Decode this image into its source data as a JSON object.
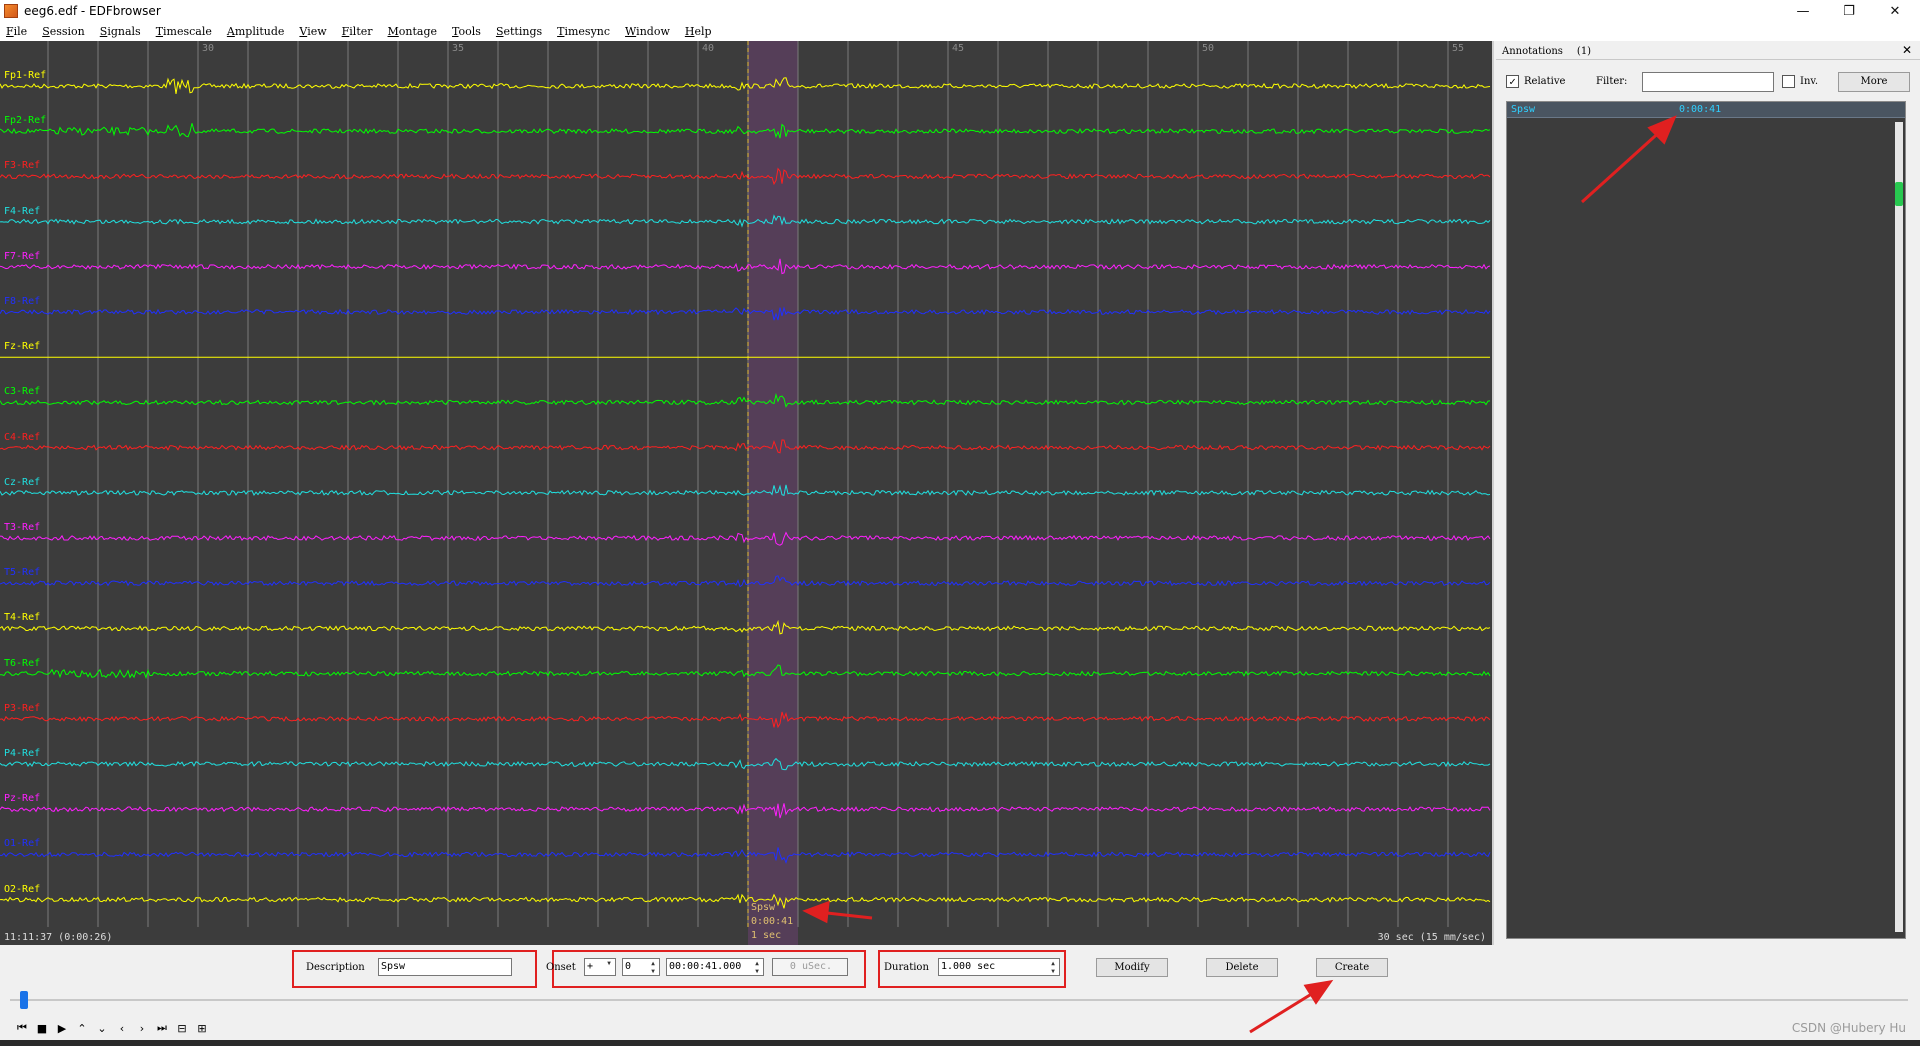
{
  "window": {
    "title": "eeg6.edf - EDFbrowser",
    "minimize_glyph": "—",
    "maximize_glyph": "❐",
    "close_glyph": "✕"
  },
  "menu": [
    "File",
    "Session",
    "Signals",
    "Timescale",
    "Amplitude",
    "View",
    "Filter",
    "Montage",
    "Tools",
    "Settings",
    "Timesync",
    "Window",
    "Help"
  ],
  "signal_view": {
    "seconds_ticks": [
      "30",
      "35",
      "40",
      "45",
      "50",
      "55"
    ],
    "channels": [
      {
        "label": "Fp1-Ref",
        "color": "#ffff00"
      },
      {
        "label": "Fp2-Ref",
        "color": "#00ff00"
      },
      {
        "label": "F3-Ref",
        "color": "#ff2020"
      },
      {
        "label": "F4-Ref",
        "color": "#20e0e0"
      },
      {
        "label": "F7-Ref",
        "color": "#ff20ff"
      },
      {
        "label": "F8-Ref",
        "color": "#2030ff"
      },
      {
        "label": "Fz-Ref",
        "color": "#ffff00"
      },
      {
        "label": "C3-Ref",
        "color": "#00ff00"
      },
      {
        "label": "C4-Ref",
        "color": "#ff2020"
      },
      {
        "label": "Cz-Ref",
        "color": "#20e0e0"
      },
      {
        "label": "T3-Ref",
        "color": "#ff20ff"
      },
      {
        "label": "T5-Ref",
        "color": "#2030ff"
      },
      {
        "label": "T4-Ref",
        "color": "#ffff00"
      },
      {
        "label": "T6-Ref",
        "color": "#00ff00"
      },
      {
        "label": "P3-Ref",
        "color": "#ff2020"
      },
      {
        "label": "P4-Ref",
        "color": "#20e0e0"
      },
      {
        "label": "Pz-Ref",
        "color": "#ff20ff"
      },
      {
        "label": "O1-Ref",
        "color": "#2030ff"
      },
      {
        "label": "O2-Ref",
        "color": "#ffff00"
      }
    ],
    "time_left": "11:11:37 (0:00:26)",
    "time_right": "30 sec  (15 mm/sec)",
    "marker_desc": "Spsw",
    "marker_time": "0:00:41",
    "marker_duration": "1 sec"
  },
  "annotations_panel": {
    "title": "Annotations",
    "count": "(1)",
    "close_glyph": "✕",
    "relative_label": "Relative",
    "relative_checked": "✓",
    "filter_label": "Filter:",
    "filter_value": "",
    "inv_label": "Inv.",
    "more_label": "More",
    "items": [
      {
        "description": "Spsw",
        "time": "0:00:41"
      }
    ]
  },
  "editor": {
    "description_label": "Description",
    "description_value": "Spsw",
    "onset_label": "Onset",
    "onset_sign": "+",
    "onset_days": "0",
    "onset_time": "00:00:41.000",
    "onset_usec": "0 uSec.",
    "duration_label": "Duration",
    "duration_value": "1.000 sec",
    "modify_label": "Modify",
    "delete_label": "Delete",
    "create_label": "Create"
  },
  "playback": [
    "⏮",
    "■",
    "▶",
    "⌃",
    "⌄",
    "‹",
    "›",
    "⏭",
    "⊟",
    "⊞"
  ],
  "watermark": "CSDN @Hubery Hu",
  "colors": {
    "signal_bg": "#3c3c3c",
    "highlight": "#6a3f6f",
    "callout_red": "#e02020"
  }
}
